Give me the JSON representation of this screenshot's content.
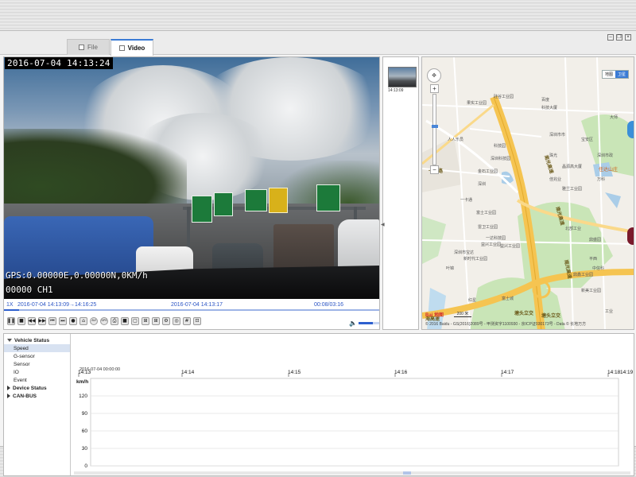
{
  "tabs": [
    {
      "label": "File",
      "active": false
    },
    {
      "label": "Video",
      "active": true
    }
  ],
  "video": {
    "osd_datetime": "2016-07-04 14:13:24",
    "osd_gps": "GPS:0.00000E,0.00000N,0KM/h",
    "osd_channel": "00000   CH1",
    "playback_speed": "1X",
    "range": "2016-07-04 14:13:09→14:16:25",
    "current_time": "2016-07-04 14:13:17",
    "position": "00:08/03:16",
    "progress_fraction": 0.04,
    "volume_fraction": 0.7,
    "controls": [
      {
        "name": "pause-icon",
        "glyph": "❚❚"
      },
      {
        "name": "stop-icon",
        "glyph": "■"
      },
      {
        "name": "rewind-icon",
        "glyph": "◀◀"
      },
      {
        "name": "fast-forward-icon",
        "glyph": "▶▶"
      },
      {
        "name": "previous-icon",
        "glyph": "⏮"
      },
      {
        "name": "next-icon",
        "glyph": "⏭"
      },
      {
        "name": "record-icon",
        "glyph": "●"
      },
      {
        "name": "home-icon",
        "glyph": "⌂"
      },
      {
        "name": "avi-icon",
        "glyph": "AVI"
      },
      {
        "name": "gps-icon",
        "glyph": "GPS"
      },
      {
        "name": "print-icon",
        "glyph": "⎙"
      },
      {
        "name": "stop-square-icon",
        "glyph": "■"
      },
      {
        "name": "layout-1-icon",
        "glyph": "▢"
      },
      {
        "name": "layout-4-icon",
        "glyph": "⊞"
      },
      {
        "name": "layout-9-icon",
        "glyph": "⊞"
      },
      {
        "name": "settings-icon",
        "glyph": "⚙"
      },
      {
        "name": "target-icon",
        "glyph": "◎"
      },
      {
        "name": "grid-icon",
        "glyph": "#"
      },
      {
        "name": "snapshot-icon",
        "glyph": "⊡"
      }
    ]
  },
  "thumbnail": {
    "label": "14:13:09"
  },
  "map": {
    "type_options": [
      "地图",
      "卫星"
    ],
    "selected_type": "地图",
    "road_labels": [
      "南光高速",
      "南光高速",
      "南光高速",
      "塘头立交",
      "塘头立交",
      "海高速",
      "一石路"
    ],
    "pois": [
      "果实工业园",
      "硅谷工业园",
      "科技大厦",
      "人人乐员",
      "深圳市市",
      "科技园",
      "宝安区",
      "深圳科技园",
      "珠光",
      "金石工业园",
      "晶源高大厦",
      "深圳市政",
      "深圳",
      "佳兆业",
      "万科",
      "一卡通",
      "雅兰工业园",
      "富士工业园",
      "雷卫工业园",
      "一达科技园",
      "益兴工业园",
      "益兴工业园",
      "深圳市宝达",
      "新时代工业园",
      "叶锦",
      "北部工业",
      "鼎盛园",
      "平西",
      "中信科",
      "鼎鑫工业园",
      "新美工业园",
      "红星",
      "富士城",
      "工业",
      "百度",
      "大师",
      "任达山庄"
    ],
    "scale": "200 米",
    "copyright": "© 2016 Baidu - GS(2016)2089号 - 甲测资字1100930 - 京ICP证030173号 - Data © 长地万方",
    "logo": "Bai 地图"
  },
  "status": {
    "tree": [
      {
        "label": "Vehicle Status",
        "kind": "parent",
        "expanded": true
      },
      {
        "label": "Speed",
        "kind": "child",
        "selected": true
      },
      {
        "label": "G-sensor",
        "kind": "child"
      },
      {
        "label": "Sensor",
        "kind": "child"
      },
      {
        "label": "IO",
        "kind": "child"
      },
      {
        "label": "Event",
        "kind": "child"
      },
      {
        "label": "Device Status",
        "kind": "parent",
        "expanded": false
      },
      {
        "label": "CAN-BUS",
        "kind": "parent",
        "expanded": false
      }
    ],
    "graph_start": "2016-07-04 00:00:00",
    "unit": "km/h",
    "x_ticks": [
      "14:13",
      "14:14",
      "14:15",
      "14:16",
      "14:17",
      "14:18"
    ],
    "x_end": "14:19",
    "y_ticks": [
      120,
      90,
      60,
      30,
      0
    ],
    "y_max": 120
  }
}
